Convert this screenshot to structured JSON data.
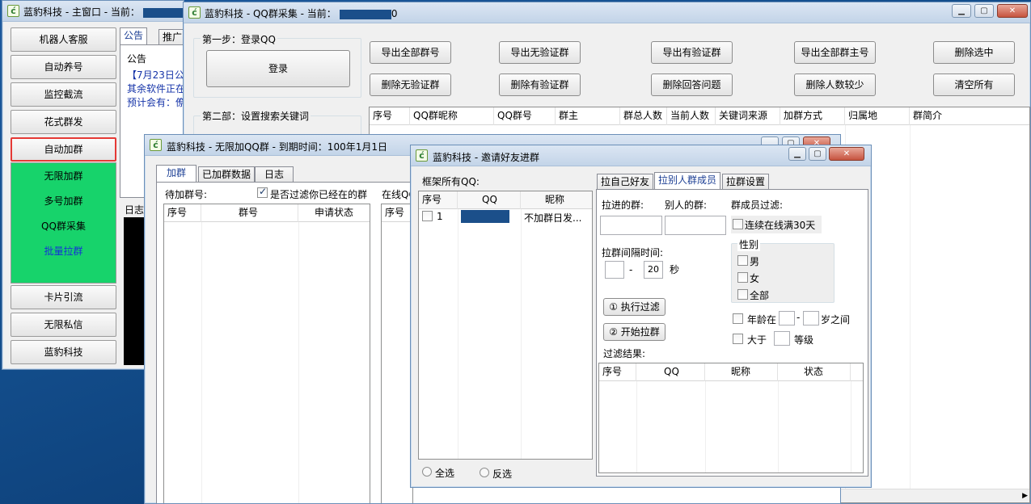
{
  "main_window": {
    "title": "蓝豹科技 - 主窗口 - 当前：",
    "nav": [
      "机器人客服",
      "自动养号",
      "监控截流",
      "花式群发",
      "自动加群"
    ],
    "submenu": [
      "无限加群",
      "多号加群",
      "QQ群采集",
      "批量拉群"
    ],
    "nav_bottom": [
      "卡片引流",
      "无限私信",
      "蓝豹科技"
    ],
    "tabs": [
      "公告",
      "推广"
    ],
    "notice_title": "公告",
    "notice_lines": [
      "【7月23日公",
      "其余软件正在",
      "预计会有：僚"
    ],
    "log_label": "日志"
  },
  "collect_window": {
    "title": "蓝豹科技 - QQ群采集 - 当前：",
    "title_tail": "0",
    "step1": "第一步：登录QQ",
    "login_button": "登录",
    "step2": "第二部：设置搜索关键词",
    "buttons_row1": [
      "导出全部群号",
      "导出无验证群",
      "导出有验证群",
      "导出全部群主号",
      "删除选中"
    ],
    "buttons_row2": [
      "删除无验证群",
      "删除有验证群",
      "删除回答问题",
      "删除人数较少",
      "清空所有"
    ],
    "columns": [
      "序号",
      "QQ群昵称",
      "QQ群号",
      "群主",
      "群总人数",
      "当前人数",
      "关键词来源",
      "加群方式",
      "归属地",
      "群简介"
    ]
  },
  "join_window": {
    "title": "蓝豹科技 - 无限加QQ群 - 到期时间：100年1月1日",
    "tabs": [
      "加群",
      "已加群数据",
      "日志"
    ],
    "pending_label": "待加群号:",
    "filter_checkbox": "是否过滤你已经在的群",
    "online_label": "在线QQ",
    "columns": [
      "序号",
      "群号",
      "申请状态"
    ],
    "right_col": "序号"
  },
  "invite_window": {
    "title": "蓝豹科技 - 邀请好友进群",
    "frame_label": "框架所有QQ:",
    "list_columns": [
      "序号",
      "QQ",
      "昵称"
    ],
    "list_rows": [
      {
        "index": "1",
        "nick": "不加群日发..."
      }
    ],
    "select_all": "全选",
    "invert": "反选",
    "tabs": [
      "拉自己好友",
      "拉别人群成员",
      "拉群设置"
    ],
    "target_group": "拉进的群:",
    "other_group": "别人的群:",
    "member_filter": "群成员过滤:",
    "online30": "连续在线满30天",
    "interval_label": "拉群间隔时间:",
    "interval_sep": "-",
    "interval_value": "20",
    "interval_unit": "秒",
    "gender_title": "性别",
    "genders": [
      "男",
      "女",
      "全部"
    ],
    "run_filter": "① 执行过滤",
    "start_pull": "② 开始拉群",
    "age_prefix": "年龄在",
    "age_dash": "-",
    "age_suffix": "岁之间",
    "level_prefix": "大于",
    "level_suffix": "等级",
    "result_label": "过滤结果:",
    "result_columns": [
      "序号",
      "QQ",
      "昵称",
      "状态"
    ]
  }
}
